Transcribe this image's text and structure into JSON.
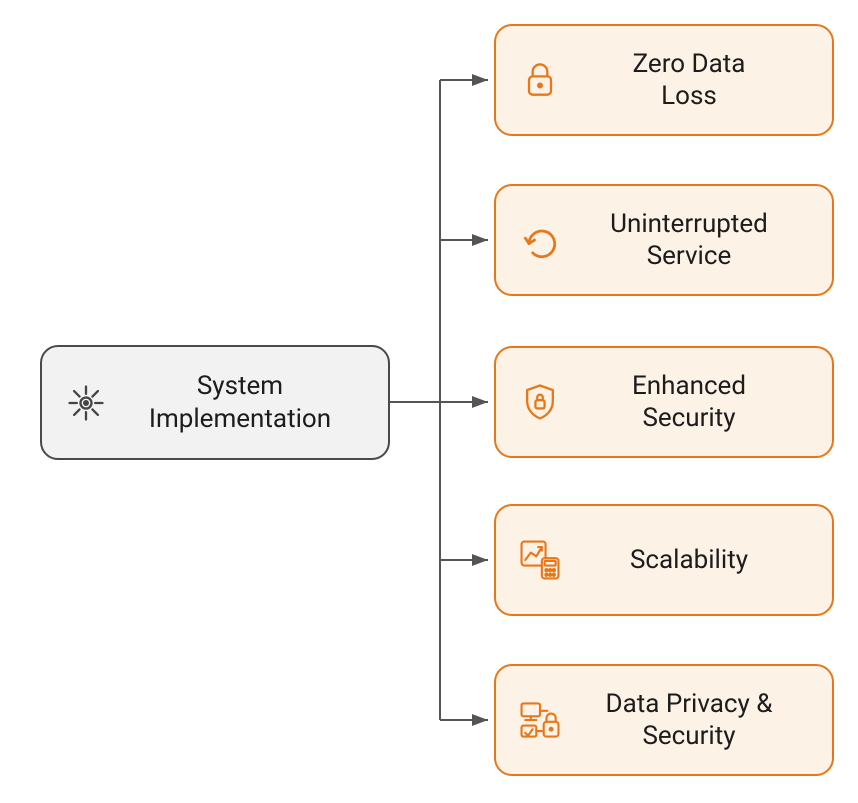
{
  "source": {
    "label": "System\nImplementation",
    "icon": "gear-icon"
  },
  "targets": [
    {
      "label": "Zero Data\nLoss",
      "icon": "lock-icon"
    },
    {
      "label": "Uninterrupted\nService",
      "icon": "undo-icon"
    },
    {
      "label": "Enhanced\nSecurity",
      "icon": "shield-lock-icon"
    },
    {
      "label": "Scalability",
      "icon": "chart-calculator-icon"
    },
    {
      "label": "Data Privacy &\nSecurity",
      "icon": "devices-lock-icon"
    }
  ],
  "colors": {
    "accent": "#e8771a",
    "sourceBorder": "#4a4a4a",
    "sourceFill": "#f2f2f2",
    "targetFill": "#fdf2e6",
    "connector": "#555"
  }
}
